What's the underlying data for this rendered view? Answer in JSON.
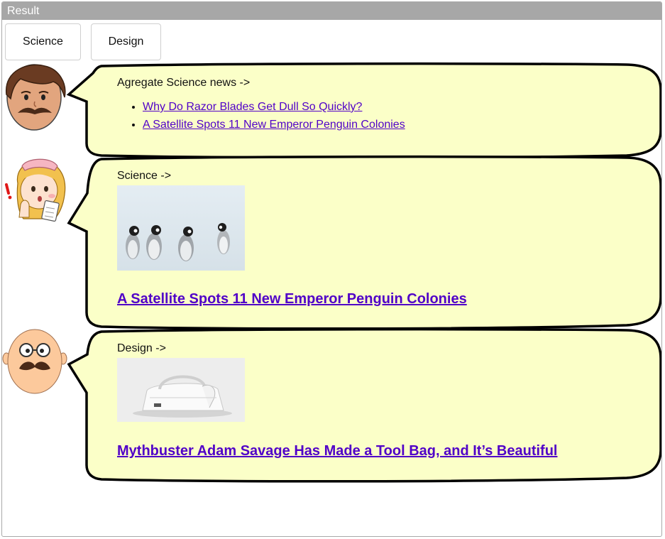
{
  "window": {
    "title": "Result"
  },
  "tabs": {
    "science": "Science",
    "design": "Design"
  },
  "bubbles": {
    "aggregate": {
      "heading": "Agregate Science news ->",
      "links": [
        "Why Do Razor Blades Get Dull So Quickly?",
        "A Satellite Spots 11 New Emperor Penguin Colonies"
      ]
    },
    "science": {
      "heading": "Science ->",
      "title": "A Satellite Spots 11 New Emperor Penguin Colonies"
    },
    "design": {
      "heading": "Design ->",
      "title": "Mythbuster Adam Savage Has Made a Tool Bag, and It’s Beautiful"
    }
  },
  "colors": {
    "bubble_fill": "#fbffc8",
    "link": "#5000c8",
    "titlebar": "#a7a7a7"
  }
}
